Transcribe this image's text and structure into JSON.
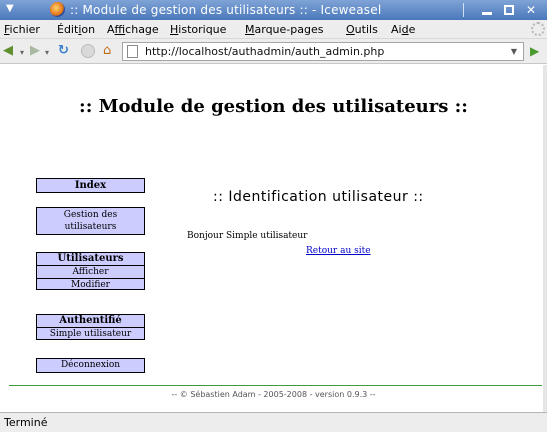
{
  "window": {
    "title": ":: Module de gestion des utilisateurs :: - Iceweasel"
  },
  "menubar": {
    "items": [
      {
        "label": "Fichier",
        "underline_index": 0
      },
      {
        "label": "Édition",
        "underline_index": 4
      },
      {
        "label": "Affichage",
        "underline_index": 1
      },
      {
        "label": "Historique",
        "underline_index": 0
      },
      {
        "label": "Marque-pages",
        "underline_index": 0
      },
      {
        "label": "Outils",
        "underline_index": 0
      },
      {
        "label": "Aide",
        "underline_index": 2
      }
    ]
  },
  "navbar": {
    "url": "http://localhost/authadmin/auth_admin.php",
    "icons": [
      "back-arrow-icon",
      "forward-arrow-icon",
      "reload-icon",
      "stop-icon",
      "home-icon",
      "page-icon",
      "go-arrow-icon"
    ]
  },
  "page": {
    "title": ":: Module de gestion des utilisateurs ::",
    "menu": {
      "index": "Index",
      "gestion": "Gestion des utilisateurs",
      "users_heading": "Utilisateurs",
      "users_items": [
        "Afficher",
        "Modifier"
      ],
      "auth_heading": "Authentifié",
      "auth_user": "Simple utilisateur",
      "logout": "Déconnexion"
    },
    "ident_title": ":: Identification utilisateur ::",
    "bonjour": "Bonjour Simple utilisateur",
    "retour_link": "Retour au site",
    "footer": "-- © Sébastien Adam - 2005-2008 - version 0.9.3 --"
  },
  "statusbar": {
    "text": "Terminé"
  },
  "colors": {
    "menu_bg": "#ccccff",
    "footer_line": "#3d9a3d",
    "link": "#0000cc",
    "titlebar": "#4a78bb"
  }
}
